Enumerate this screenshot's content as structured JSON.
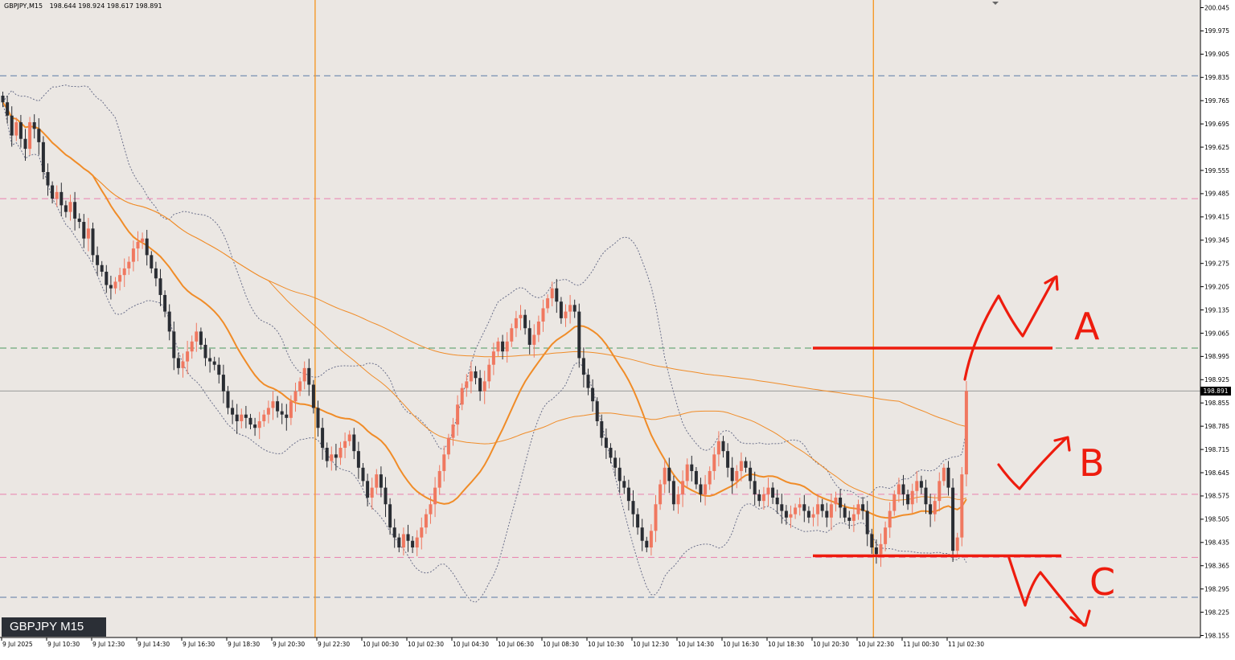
{
  "header": {
    "symbol_timeframe": "GBPJPY,M15",
    "ohlc": "198.644 198.924 198.617 198.891"
  },
  "badge": {
    "label": "GBPJPY M15"
  },
  "current_price_label": "198.891",
  "annotations": {
    "a": "A",
    "b": "B",
    "c": "C"
  },
  "colors": {
    "background": "#ebe7e3",
    "bull_candle": "#f07860",
    "bear_candle": "#2a2d33",
    "ma_orange": "#f08c28",
    "bollinger": "#6a6f8a",
    "annotation_red": "#ee1c0e",
    "session_line": "#f59a2a",
    "hline_blue": "#5b7aa6",
    "hline_pink": "#e97fae",
    "hline_green": "#4e9a62"
  },
  "chart_data": {
    "type": "candlestick",
    "symbol": "GBPJPY",
    "timeframe": "M15",
    "ylim": [
      198.155,
      200.045
    ],
    "y_ticks": [
      "200.045",
      "199.975",
      "199.905",
      "199.835",
      "199.765",
      "199.695",
      "199.625",
      "199.555",
      "199.485",
      "199.415",
      "199.345",
      "199.275",
      "199.205",
      "199.135",
      "199.065",
      "198.995",
      "198.925",
      "198.855",
      "198.785",
      "198.715",
      "198.645",
      "198.575",
      "198.505",
      "198.435",
      "198.365",
      "198.295",
      "198.225",
      "198.155"
    ],
    "x_ticks": [
      "9 Jul 2025",
      "9 Jul 10:30",
      "9 Jul 12:30",
      "9 Jul 14:30",
      "9 Jul 16:30",
      "9 Jul 18:30",
      "9 Jul 20:30",
      "9 Jul 22:30",
      "10 Jul 00:30",
      "10 Jul 02:30",
      "10 Jul 04:30",
      "10 Jul 06:30",
      "10 Jul 08:30",
      "10 Jul 10:30",
      "10 Jul 12:30",
      "10 Jul 14:30",
      "10 Jul 16:30",
      "10 Jul 18:30",
      "10 Jul 20:30",
      "10 Jul 22:30",
      "11 Jul 00:30",
      "11 Jul 02:30"
    ],
    "current_price": 198.891,
    "horizontal_lines": [
      {
        "price": 199.84,
        "style": "dashed",
        "color": "blue"
      },
      {
        "price": 199.47,
        "style": "dashed",
        "color": "pink"
      },
      {
        "price": 199.02,
        "style": "dashed",
        "color": "green"
      },
      {
        "price": 198.58,
        "style": "dashed",
        "color": "pink"
      },
      {
        "price": 198.39,
        "style": "dashed",
        "color": "pink"
      },
      {
        "price": 198.27,
        "style": "dashed",
        "color": "blue"
      }
    ],
    "session_dividers_index": [
      69,
      193
    ],
    "annotation_levels": {
      "upper": 199.02,
      "lower": 198.395
    },
    "closes": [
      199.76,
      199.72,
      199.66,
      199.7,
      199.65,
      199.62,
      199.7,
      199.68,
      199.64,
      199.55,
      199.51,
      199.47,
      199.49,
      199.45,
      199.43,
      199.46,
      199.41,
      199.4,
      199.35,
      199.38,
      199.3,
      199.27,
      199.25,
      199.21,
      199.2,
      199.22,
      199.24,
      199.26,
      199.28,
      199.32,
      199.34,
      199.35,
      199.3,
      199.26,
      199.23,
      199.18,
      199.13,
      199.07,
      198.99,
      198.96,
      198.98,
      199.01,
      199.04,
      199.07,
      199.03,
      198.99,
      198.98,
      198.97,
      198.94,
      198.89,
      198.84,
      198.82,
      198.8,
      198.82,
      198.81,
      198.79,
      198.78,
      198.8,
      198.82,
      198.84,
      198.86,
      198.83,
      198.82,
      198.81,
      198.86,
      198.89,
      198.92,
      198.96,
      198.91,
      198.84,
      198.78,
      198.72,
      198.68,
      198.7,
      198.69,
      198.72,
      198.74,
      198.76,
      198.71,
      198.66,
      198.62,
      198.57,
      198.6,
      198.64,
      198.6,
      198.55,
      198.48,
      198.45,
      198.42,
      198.46,
      198.44,
      198.42,
      198.45,
      198.48,
      198.52,
      198.55,
      198.6,
      198.65,
      198.7,
      198.75,
      198.79,
      198.85,
      198.9,
      198.92,
      198.95,
      198.93,
      198.89,
      198.92,
      198.97,
      199.01,
      199.04,
      199.01,
      199.04,
      199.08,
      199.11,
      199.12,
      199.08,
      199.03,
      199.06,
      199.1,
      199.14,
      199.17,
      199.2,
      199.16,
      199.11,
      199.13,
      199.15,
      199.13,
      198.99,
      198.94,
      198.9,
      198.86,
      198.8,
      198.75,
      198.72,
      198.69,
      198.66,
      198.62,
      198.6,
      198.56,
      198.52,
      198.48,
      198.44,
      198.42,
      198.47,
      198.55,
      198.61,
      198.66,
      198.62,
      198.55,
      198.58,
      198.62,
      198.67,
      198.65,
      198.61,
      198.58,
      198.61,
      198.65,
      198.7,
      198.74,
      198.71,
      198.66,
      198.62,
      198.65,
      198.68,
      198.66,
      198.62,
      198.58,
      198.56,
      198.58,
      198.6,
      198.57,
      198.55,
      198.53,
      198.51,
      198.52,
      198.54,
      198.55,
      198.53,
      198.51,
      198.52,
      198.55,
      198.53,
      198.51,
      198.55,
      198.57,
      198.54,
      198.51,
      198.5,
      198.52,
      198.55,
      198.53,
      198.46,
      198.42,
      198.4,
      198.43,
      198.48,
      198.53,
      198.58,
      198.61,
      198.58,
      198.55,
      198.59,
      198.62,
      198.6,
      198.55,
      198.52,
      198.56,
      198.62,
      198.66,
      198.6,
      198.41,
      198.45,
      198.64,
      198.891
    ]
  }
}
